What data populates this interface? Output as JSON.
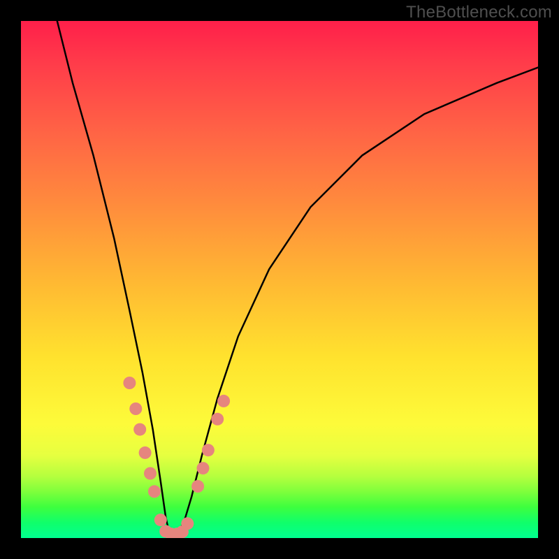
{
  "watermark": "TheBottleneck.com",
  "chart_data": {
    "type": "line",
    "title": "",
    "xlabel": "",
    "ylabel": "",
    "xlim": [
      0,
      100
    ],
    "ylim": [
      0,
      100
    ],
    "gradient_stops": [
      {
        "pos": 0,
        "color": "#ff1f4a"
      },
      {
        "pos": 22,
        "color": "#ff6545"
      },
      {
        "pos": 50,
        "color": "#ffb733"
      },
      {
        "pos": 78,
        "color": "#fdfb3a"
      },
      {
        "pos": 94,
        "color": "#3eff3e"
      },
      {
        "pos": 100,
        "color": "#00ff90"
      }
    ],
    "series": [
      {
        "name": "bottleneck-curve",
        "color": "#000000",
        "x": [
          7,
          10,
          14,
          18,
          21,
          23.5,
          25.5,
          27,
          28,
          28.8,
          30,
          31.5,
          33,
          35,
          38,
          42,
          48,
          56,
          66,
          78,
          92,
          100
        ],
        "y": [
          100,
          88,
          74,
          58,
          44,
          32,
          21,
          11,
          4,
          0.5,
          0.5,
          3,
          8,
          16,
          27,
          39,
          52,
          64,
          74,
          82,
          88,
          91
        ]
      }
    ],
    "scatter": {
      "name": "highlighted-points",
      "color": "#e6857e",
      "radius": 9,
      "points": [
        {
          "x": 21.0,
          "y": 30.0
        },
        {
          "x": 22.2,
          "y": 25.0
        },
        {
          "x": 23.0,
          "y": 21.0
        },
        {
          "x": 24.0,
          "y": 16.5
        },
        {
          "x": 25.0,
          "y": 12.5
        },
        {
          "x": 25.8,
          "y": 9.0
        },
        {
          "x": 27.0,
          "y": 3.5
        },
        {
          "x": 28.0,
          "y": 1.3
        },
        {
          "x": 29.0,
          "y": 0.8
        },
        {
          "x": 30.2,
          "y": 0.8
        },
        {
          "x": 31.2,
          "y": 1.2
        },
        {
          "x": 32.2,
          "y": 2.8
        },
        {
          "x": 34.2,
          "y": 10.0
        },
        {
          "x": 35.2,
          "y": 13.5
        },
        {
          "x": 36.2,
          "y": 17.0
        },
        {
          "x": 38.0,
          "y": 23.0
        },
        {
          "x": 39.2,
          "y": 26.5
        }
      ]
    }
  }
}
